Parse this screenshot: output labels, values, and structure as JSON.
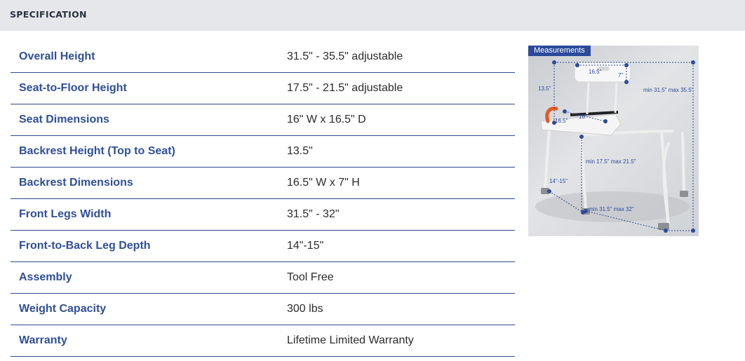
{
  "header": {
    "title": "SPECIFICATION"
  },
  "specs": [
    {
      "label": "Overall Height",
      "value": "31.5\" - 35.5\" adjustable"
    },
    {
      "label": "Seat-to-Floor Height",
      "value": "17.5\" - 21.5\" adjustable"
    },
    {
      "label": "Seat Dimensions",
      "value": "16\" W x 16.5\" D"
    },
    {
      "label": "Backrest Height (Top to Seat)",
      "value": "13.5\""
    },
    {
      "label": "Backrest Dimensions",
      "value": "16.5\" W x 7\" H"
    },
    {
      "label": "Front Legs Width",
      "value": "31.5\" - 32\""
    },
    {
      "label": "Front-to-Back Leg Depth",
      "value": "14\"-15\""
    },
    {
      "label": "Assembly",
      "value": "Tool Free"
    },
    {
      "label": "Weight Capacity",
      "value": "300 lbs"
    },
    {
      "label": "Warranty",
      "value": "Lifetime Limited Warranty"
    }
  ],
  "image": {
    "tag": "Measurements",
    "dims": {
      "backrest_width": "16.5\"",
      "backrest_height": "7\"",
      "backrest_top": "13.5\"",
      "overall_height": "min 31.5\" max 35.5\"",
      "seat_width": "16\"",
      "seat_depth": "16.5\"",
      "seat_height": "min 17.5\" max 21.5\"",
      "leg_depth": "14\"-15\"",
      "leg_width": "min 31.5\" max 32\""
    }
  },
  "colors": {
    "accent": "#2f4f96",
    "divider": "#2e4a8a",
    "header_bg": "#e6e7eb"
  }
}
